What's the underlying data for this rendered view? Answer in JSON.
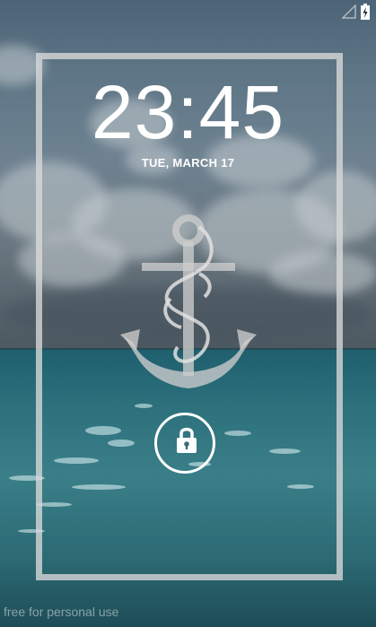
{
  "status_bar": {
    "signal_icon": "signal-empty-icon",
    "battery_icon": "battery-charging-icon"
  },
  "lockscreen": {
    "time": "23:45",
    "date": "TUE, MARCH 17",
    "wallpaper_icon": "anchor-icon",
    "unlock_icon": "lock-icon"
  },
  "watermark": "free for personal use",
  "colors": {
    "frame": "#dadada",
    "text": "#ffffff",
    "sea": "#2b6f7b",
    "sky": "#5f7686"
  }
}
